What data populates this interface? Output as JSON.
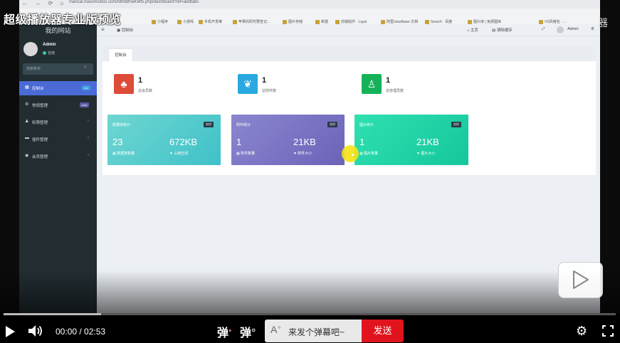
{
  "overlay": {
    "title": "超级播放器专业版预览",
    "right_char": "器"
  },
  "browser": {
    "url": "mancal.macemsbox.com/tdf/8bf0aKMt5.php/dashboard?ref=addtabs",
    "bookmarks": [
      "小程序",
      "小游戏",
      "手机开发维",
      "苹果的研究要查记...",
      "图片存储",
      "新建",
      "前端组件 · Layui",
      "阿里cloudbase 文档",
      "Search · 百度",
      "图片库 | 免费图库",
      "VS风格包 · ..."
    ]
  },
  "sidebar": {
    "site_name": "我的网站",
    "user": {
      "name": "Admin",
      "status": "在线"
    },
    "search_placeholder": "搜索菜单",
    "items": [
      {
        "label": "控制台",
        "badge": "hot",
        "icon": "dashboard-icon"
      },
      {
        "label": "常规管理",
        "badge": "new",
        "icon": "cogs-icon"
      },
      {
        "label": "权限管理",
        "badge": "",
        "icon": "group-icon"
      },
      {
        "label": "插件管理",
        "badge": "",
        "icon": "plugin-icon"
      },
      {
        "label": "会员管理",
        "badge": "",
        "icon": "user-icon"
      }
    ]
  },
  "topbar": {
    "breadcrumb": "控制台",
    "home": "主页",
    "clear_cache": "清除缓存",
    "user": "Admin"
  },
  "tab": "控制台",
  "stats": [
    {
      "value": "1",
      "label": "总会员数",
      "color": "#dd4b39",
      "icon": "users-icon"
    },
    {
      "value": "1",
      "label": "总附件数",
      "color": "#29a9e0",
      "icon": "leaf-icon"
    },
    {
      "value": "1",
      "label": "总管理员数",
      "color": "#16b25a",
      "icon": "user-admin-icon"
    }
  ],
  "cards": [
    {
      "title": "数据库统计",
      "tag": "实时",
      "n1": "23",
      "n2": "672KB",
      "s1": "数据表数量",
      "s2": "占用空间",
      "bg": "#4fd1c5"
    },
    {
      "title": "附件统计",
      "tag": "实时",
      "n1": "1",
      "n2": "21KB",
      "s1": "附件数量",
      "s2": "附件大小",
      "bg": "#7b73c7"
    },
    {
      "title": "图片统计",
      "tag": "实时",
      "n1": "1",
      "n2": "21KB",
      "s1": "图片数量",
      "s2": "图片大小",
      "bg": "#18d0a3"
    }
  ],
  "player": {
    "progress": 0.159,
    "time": "00:00 / 02:53",
    "danmaku_placeholder": "来发个弹幕吧~",
    "send_label": "发送",
    "dm1": "弹",
    "dm2": "弹",
    "dm_font_icon": "A"
  }
}
